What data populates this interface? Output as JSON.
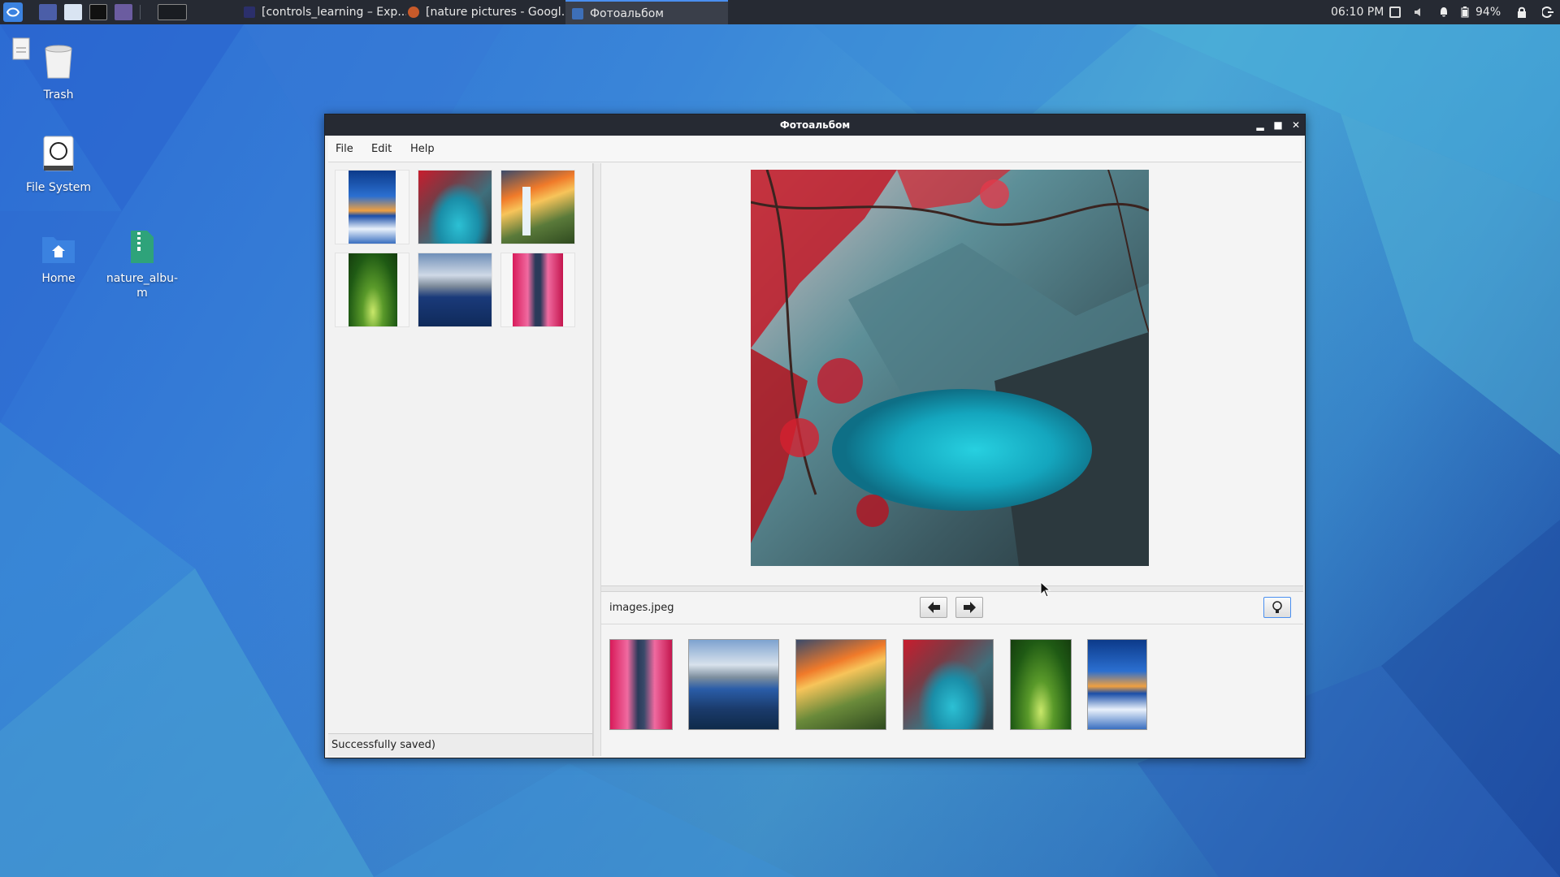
{
  "taskbar": {
    "clock": "06:10 PM",
    "battery": "94%",
    "tasks": [
      {
        "label": "[controls_learning – Exp..."
      },
      {
        "label": "[nature pictures - Googl..."
      },
      {
        "label": "Фотоальбом"
      }
    ]
  },
  "desktop": {
    "icons": [
      {
        "label": "Trash"
      },
      {
        "label": "File System"
      },
      {
        "label": "Home"
      },
      {
        "label": "nature_albu-m"
      }
    ]
  },
  "window": {
    "title": "Фотоальбом",
    "menu": [
      "File",
      "Edit",
      "Help"
    ],
    "status": "Successfully saved)",
    "current_file": "images.jpeg"
  },
  "colors": {
    "accent": "#4a8ff0",
    "panel": "#262a33"
  }
}
